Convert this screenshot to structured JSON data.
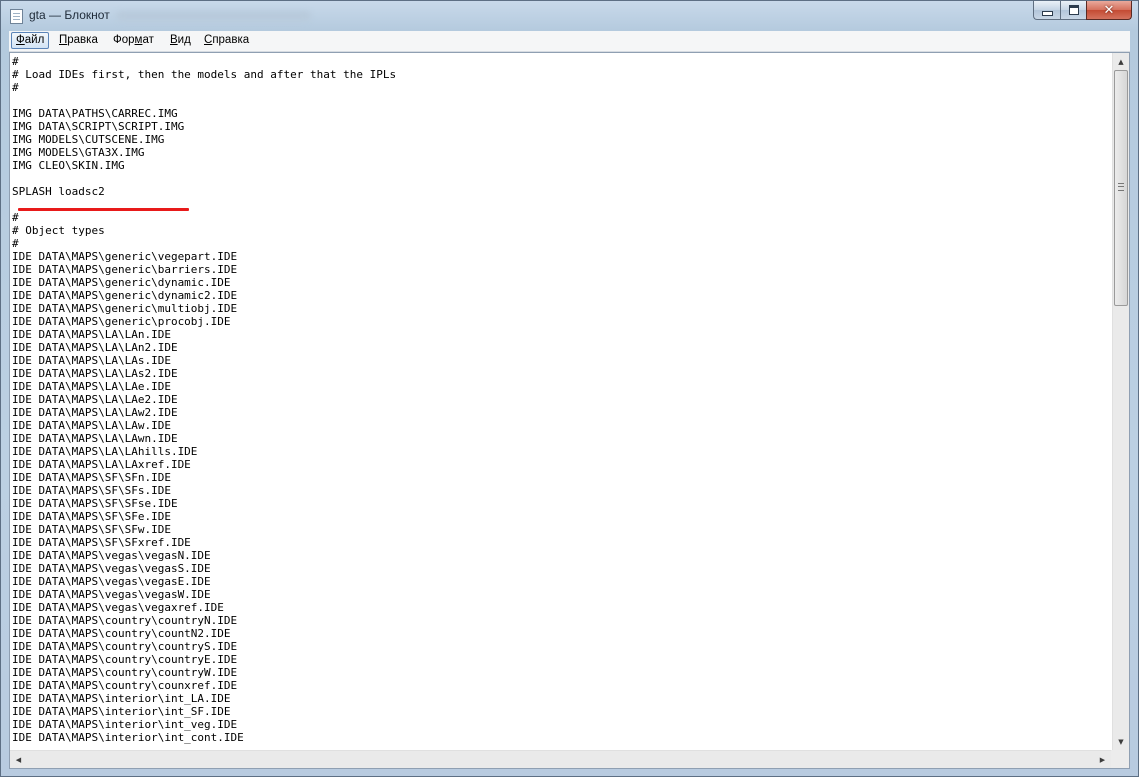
{
  "window": {
    "title": "gta — Блокнот",
    "app_icon": "notepad-icon",
    "caption": {
      "minimize": "minimize-icon",
      "maximize": "maximize-icon",
      "close": "✕"
    }
  },
  "menu": {
    "file_u": "Ф",
    "file_rest": "айл",
    "edit_u": "П",
    "edit_rest": "равка",
    "format_pre": "Фор",
    "format_u": "м",
    "format_rest": "ат",
    "view_u": "В",
    "view_rest": "ид",
    "help_u": "С",
    "help_rest": "правка"
  },
  "editor": {
    "content": "#\n# Load IDEs first, then the models and after that the IPLs\n#\n\nIMG DATA\\PATHS\\CARREC.IMG\nIMG DATA\\SCRIPT\\SCRIPT.IMG\nIMG MODELS\\CUTSCENE.IMG\nIMG MODELS\\GTA3X.IMG\nIMG CLEO\\SKIN.IMG\n\nSPLASH loadsc2\n\n#\n# Object types\n#\nIDE DATA\\MAPS\\generic\\vegepart.IDE\nIDE DATA\\MAPS\\generic\\barriers.IDE\nIDE DATA\\MAPS\\generic\\dynamic.IDE\nIDE DATA\\MAPS\\generic\\dynamic2.IDE\nIDE DATA\\MAPS\\generic\\multiobj.IDE\nIDE DATA\\MAPS\\generic\\procobj.IDE\nIDE DATA\\MAPS\\LA\\LAn.IDE\nIDE DATA\\MAPS\\LA\\LAn2.IDE\nIDE DATA\\MAPS\\LA\\LAs.IDE\nIDE DATA\\MAPS\\LA\\LAs2.IDE\nIDE DATA\\MAPS\\LA\\LAe.IDE\nIDE DATA\\MAPS\\LA\\LAe2.IDE\nIDE DATA\\MAPS\\LA\\LAw2.IDE\nIDE DATA\\MAPS\\LA\\LAw.IDE\nIDE DATA\\MAPS\\LA\\LAwn.IDE\nIDE DATA\\MAPS\\LA\\LAhills.IDE\nIDE DATA\\MAPS\\LA\\LAxref.IDE\nIDE DATA\\MAPS\\SF\\SFn.IDE\nIDE DATA\\MAPS\\SF\\SFs.IDE\nIDE DATA\\MAPS\\SF\\SFse.IDE\nIDE DATA\\MAPS\\SF\\SFe.IDE\nIDE DATA\\MAPS\\SF\\SFw.IDE\nIDE DATA\\MAPS\\SF\\SFxref.IDE\nIDE DATA\\MAPS\\vegas\\vegasN.IDE\nIDE DATA\\MAPS\\vegas\\vegasS.IDE\nIDE DATA\\MAPS\\vegas\\vegasE.IDE\nIDE DATA\\MAPS\\vegas\\vegasW.IDE\nIDE DATA\\MAPS\\vegas\\vegaxref.IDE\nIDE DATA\\MAPS\\country\\countryN.IDE\nIDE DATA\\MAPS\\country\\countN2.IDE\nIDE DATA\\MAPS\\country\\countryS.IDE\nIDE DATA\\MAPS\\country\\countryE.IDE\nIDE DATA\\MAPS\\country\\countryW.IDE\nIDE DATA\\MAPS\\country\\counxref.IDE\nIDE DATA\\MAPS\\interior\\int_LA.IDE\nIDE DATA\\MAPS\\interior\\int_SF.IDE\nIDE DATA\\MAPS\\interior\\int_veg.IDE\nIDE DATA\\MAPS\\interior\\int_cont.IDE",
    "highlight_color": "#e81a1a"
  },
  "scrollbars": {
    "up": "▲",
    "down": "▼",
    "left": "◀",
    "right": "▶",
    "vertical_thumb_fraction": 0.34
  }
}
